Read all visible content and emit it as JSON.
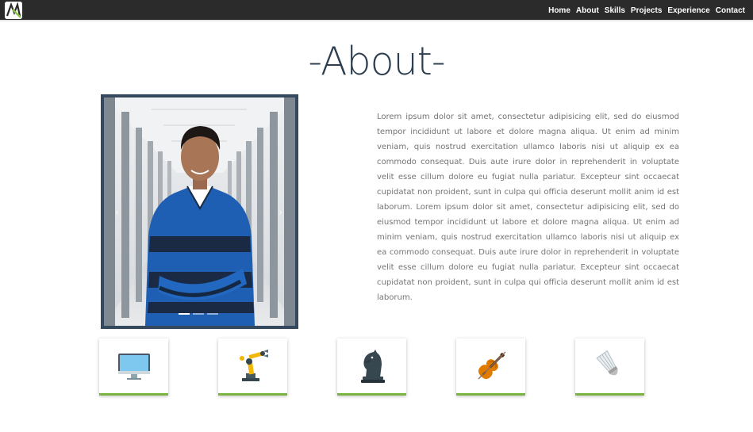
{
  "nav": {
    "logo": "logo-icon",
    "links": [
      "Home",
      "About",
      "Skills",
      "Projects",
      "Experience",
      "Contact"
    ]
  },
  "about": {
    "title": "-About-",
    "paragraph": "Lorem ipsum dolor sit amet, consectetur adipisicing elit, sed do eiusmod tempor incididunt ut labore et dolore magna aliqua. Ut enim ad minim veniam, quis nostrud exercitation ullamco laboris nisi ut aliquip ex ea commodo consequat. Duis aute irure dolor in reprehenderit in voluptate velit esse cillum dolore eu fugiat nulla pariatur. Excepteur sint occaecat cupidatat non proident, sunt in culpa qui officia deserunt mollit anim id est laborum. Lorem ipsum dolor sit amet, consectetur adipisicing elit, sed do eiusmod tempor incididunt ut labore et dolore magna aliqua. Ut enim ad minim veniam, quis nostrud exercitation ullamco laboris nisi ut aliquip ex ea commodo consequat. Duis aute irure dolor in reprehenderit in voluptate velit esse cillum dolore eu fugiat nulla pariatur. Excepteur sint occaecat cupidatat non proident, sunt in culpa qui officia deserunt mollit anim id est laborum."
  },
  "carousel": {
    "prev_arrow": "‹",
    "next_arrow": "›",
    "indicator_count": 3,
    "active_indicator": 0,
    "frame_color": "#34495e"
  },
  "hobbies": [
    {
      "icon": "computer-monitor-icon"
    },
    {
      "icon": "robotic-arm-icon"
    },
    {
      "icon": "chess-knight-icon"
    },
    {
      "icon": "violin-icon"
    },
    {
      "icon": "shuttlecock-icon"
    }
  ],
  "colors": {
    "navbar": "#2b2b2b",
    "title": "#2c3e50",
    "card_accent": "#7cb342",
    "body_text": "#757575"
  }
}
